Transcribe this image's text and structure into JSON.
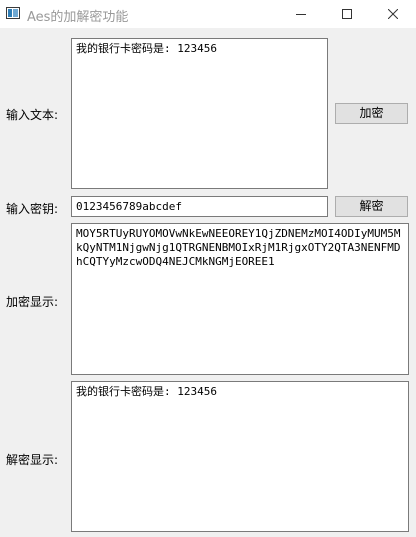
{
  "window": {
    "title": "Aes的加解密功能",
    "icon": "app-window-icon",
    "controls": [
      "minimize-icon",
      "maximize-icon",
      "close-icon"
    ]
  },
  "labels": {
    "input_text": "输入文本:",
    "key": "输入密钥:",
    "encrypted": "加密显示:",
    "decrypted": "解密显示:"
  },
  "fields": {
    "input_text": "我的银行卡密码是: 123456",
    "key": "0123456789abcdef",
    "encrypted": "MOY5RTUyRUYOMOVwNkEwNEEOREY1QjZDNEMzMOI4ODIyMUM5MkQyNTM1NjgwNjg1QTRGNENBMOIxRjM1RjgxOTY2QTA3NENFMDhCQTYyMzcwODQ4NEJCMkNGMjEOREE1",
    "decrypted": "我的银行卡密码是: 123456"
  },
  "buttons": {
    "encrypt": "加密",
    "decrypt": "解密"
  },
  "colors": {
    "window_bg": "#f0f0f0",
    "titlebar_bg": "#ffffff",
    "title_text": "#999999",
    "field_border": "#7a7a7a",
    "button_bg": "#e1e1e1",
    "button_border": "#adadad"
  }
}
